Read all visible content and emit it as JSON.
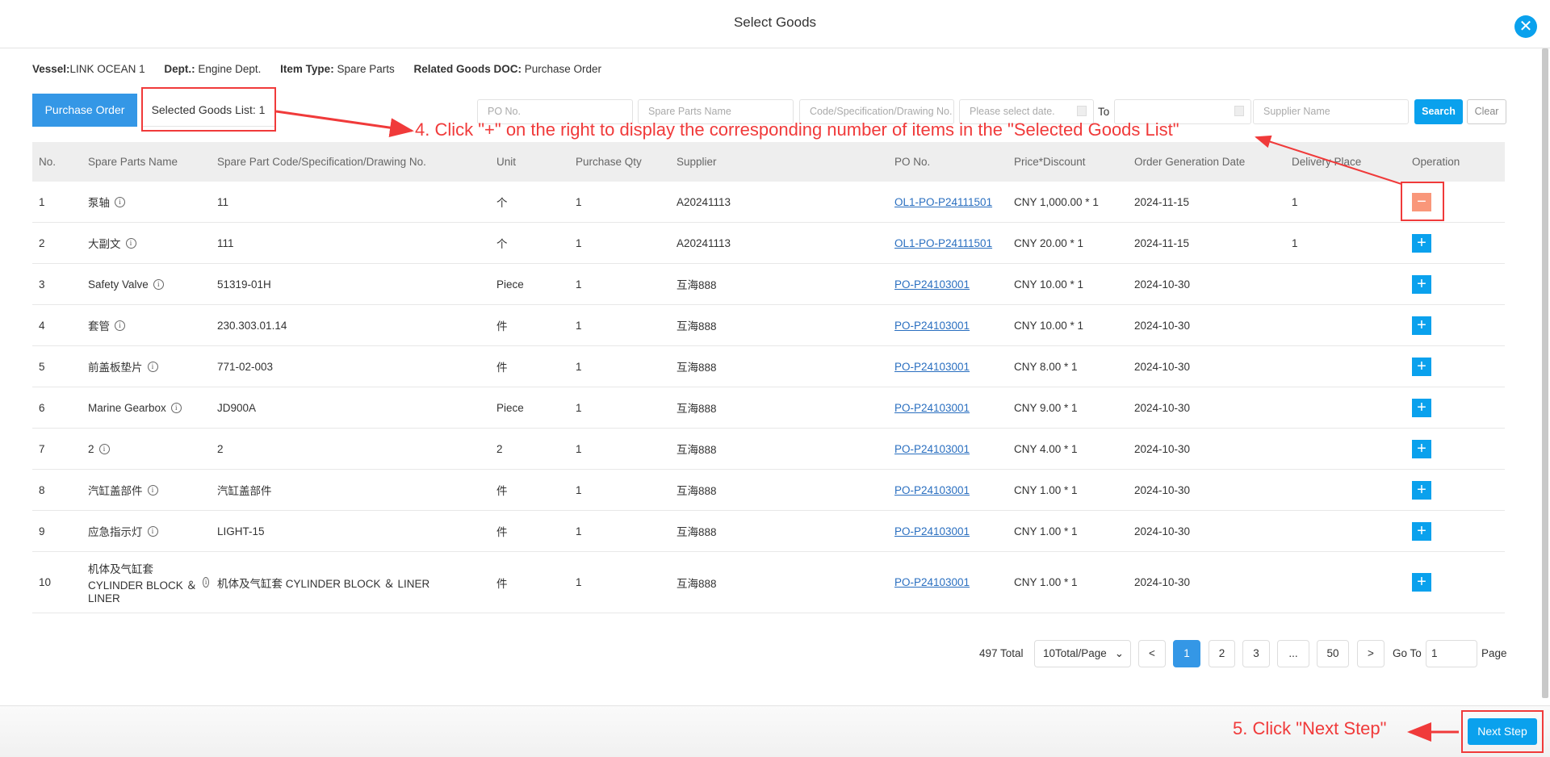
{
  "dialog": {
    "title": "Select Goods",
    "close_icon": "close-icon"
  },
  "info": {
    "vessel_label": "Vessel:",
    "vessel": "LINK OCEAN 1",
    "dept_label": "Dept.:",
    "dept": " Engine Dept.",
    "type_label": "Item Type:",
    "type": " Spare Parts",
    "doc_label": "Related Goods DOC:",
    "doc": " Purchase Order"
  },
  "tabs": {
    "purchase_order": "Purchase Order",
    "selected": "Selected Goods List: 1"
  },
  "filters": {
    "po": "PO No.",
    "name": "Spare Parts Name",
    "code": "Code/Specification/Drawing No.",
    "date_from": "Please select date.",
    "to": "To",
    "date_to": "",
    "supplier": "Supplier Name",
    "search": "Search",
    "clear": "Clear"
  },
  "table": {
    "headers": [
      "No.",
      "Spare Parts Name",
      "Spare Part Code/Specification/Drawing No.",
      "Unit",
      "Purchase Qty",
      "Supplier",
      "PO No.",
      "Price*Discount",
      "Order Generation Date",
      "Delivery Place",
      "Operation"
    ],
    "rows": [
      {
        "no": "1",
        "name": "泵轴",
        "code": "11",
        "unit": "个",
        "qty": "1",
        "supplier": "A20241113",
        "po": "OL1-PO-P24111501",
        "price": "CNY 1,000.00 * 1",
        "date": "2024-11-15",
        "place": "1",
        "op": "minus"
      },
      {
        "no": "2",
        "name": "大副文",
        "code": "111",
        "unit": "个",
        "qty": "1",
        "supplier": "A20241113",
        "po": "OL1-PO-P24111501",
        "price": "CNY 20.00 * 1",
        "date": "2024-11-15",
        "place": "1",
        "op": "plus"
      },
      {
        "no": "3",
        "name": "Safety Valve",
        "code": "51319-01H",
        "unit": "Piece",
        "qty": "1",
        "supplier": "互海888",
        "po": "PO-P24103001",
        "price": "CNY 10.00 * 1",
        "date": "2024-10-30",
        "place": "",
        "op": "plus"
      },
      {
        "no": "4",
        "name": "套管",
        "code": "230.303.01.14",
        "unit": "件",
        "qty": "1",
        "supplier": "互海888",
        "po": "PO-P24103001",
        "price": "CNY 10.00 * 1",
        "date": "2024-10-30",
        "place": "",
        "op": "plus"
      },
      {
        "no": "5",
        "name": "前盖板垫片",
        "code": "771-02-003",
        "unit": "件",
        "qty": "1",
        "supplier": "互海888",
        "po": "PO-P24103001",
        "price": "CNY 8.00 * 1",
        "date": "2024-10-30",
        "place": "",
        "op": "plus"
      },
      {
        "no": "6",
        "name": "Marine Gearbox",
        "code": "JD900A",
        "unit": "Piece",
        "qty": "1",
        "supplier": "互海888",
        "po": "PO-P24103001",
        "price": "CNY 9.00 * 1",
        "date": "2024-10-30",
        "place": "",
        "op": "plus"
      },
      {
        "no": "7",
        "name": "2",
        "code": "2",
        "unit": "2",
        "qty": "1",
        "supplier": "互海888",
        "po": "PO-P24103001",
        "price": "CNY 4.00 * 1",
        "date": "2024-10-30",
        "place": "",
        "op": "plus"
      },
      {
        "no": "8",
        "name": "汽缸盖部件",
        "code": "汽缸盖部件",
        "unit": "件",
        "qty": "1",
        "supplier": "互海888",
        "po": "PO-P24103001",
        "price": "CNY 1.00 * 1",
        "date": "2024-10-30",
        "place": "",
        "op": "plus"
      },
      {
        "no": "9",
        "name": "应急指示灯",
        "code": "LIGHT-15",
        "unit": "件",
        "qty": "1",
        "supplier": "互海888",
        "po": "PO-P24103001",
        "price": "CNY 1.00 * 1",
        "date": "2024-10-30",
        "place": "",
        "op": "plus"
      },
      {
        "no": "10",
        "name": "机体及气缸套 CYLINDER BLOCK ＆ LINER",
        "code": "机体及气缸套 CYLINDER BLOCK ＆ LINER",
        "unit": "件",
        "qty": "1",
        "supplier": "互海888",
        "po": "PO-P24103001",
        "price": "CNY 1.00 * 1",
        "date": "2024-10-30",
        "place": "",
        "op": "plus"
      }
    ]
  },
  "pagination": {
    "total": "497 Total",
    "page_size": "10Total/Page",
    "prev": "<",
    "pages": [
      "1",
      "2",
      "3",
      "...",
      "50"
    ],
    "current": "1",
    "next": ">",
    "goto_label": "Go To",
    "goto_value": "1",
    "page_label": "Page"
  },
  "footer": {
    "next_step": "Next Step"
  },
  "annotations": {
    "step4": "4. Click \"+\" on the right to display the corresponding number of items in the \"Selected Goods List\"",
    "step5": "5. Click \"Next Step\"",
    "color": "#f03a3a"
  },
  "colors": {
    "primary": "#0aa1ed",
    "tab": "#3497e6",
    "remove": "#f9977a"
  }
}
